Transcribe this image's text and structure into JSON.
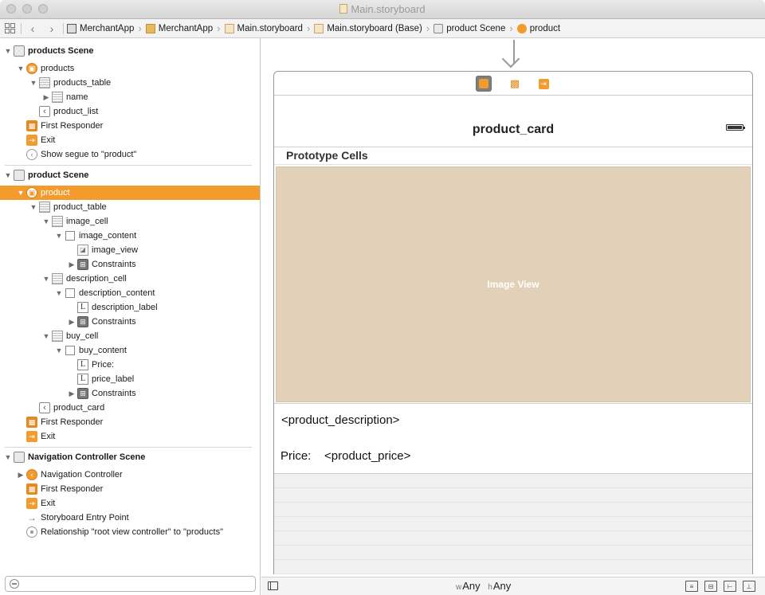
{
  "window": {
    "title": "Main.storyboard"
  },
  "jumpbar": {
    "crumbs": [
      "MerchantApp",
      "MerchantApp",
      "Main.storyboard",
      "Main.storyboard (Base)",
      "product Scene",
      "product"
    ]
  },
  "outline": {
    "items": [
      "products Scene",
      "products",
      "products_table",
      "name",
      "product_list",
      "First Responder",
      "Exit",
      "Show segue to \"product\"",
      "product Scene",
      "product",
      "product_table",
      "image_cell",
      "image_content",
      "image_view",
      "Constraints",
      "description_cell",
      "description_content",
      "description_label",
      "Constraints",
      "buy_cell",
      "buy_content",
      "Price:",
      "price_label",
      "Constraints",
      "product_card",
      "First Responder",
      "Exit",
      "Navigation Controller Scene",
      "Navigation Controller",
      "First Responder",
      "Exit",
      "Storyboard Entry Point",
      "Relationship \"root view controller\" to \"products\""
    ],
    "filter_placeholder": ""
  },
  "canvas": {
    "nav_title": "product_card",
    "prototype_header": "Prototype Cells",
    "image_view_label": "Image View",
    "description_text": "<product_description>",
    "price_label": "Price:",
    "price_value": "<product_price>"
  },
  "bottombar": {
    "w_prefix": "w",
    "w_value": "Any",
    "h_prefix": "h",
    "h_value": "Any"
  },
  "colors": {
    "selection": "#f39c2d",
    "image_view_bg": "#e2d1b8"
  }
}
